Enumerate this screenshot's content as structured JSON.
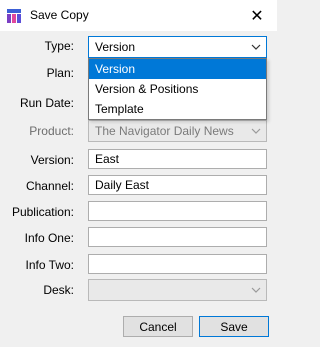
{
  "window": {
    "title": "Save Copy",
    "icon": "save-copy-app-icon",
    "close_glyph": "✕"
  },
  "form": {
    "type": {
      "label": "Type:",
      "value": "Version",
      "options": [
        "Version",
        "Version & Positions",
        "Template"
      ]
    },
    "plan": {
      "label": "Plan:"
    },
    "run_date": {
      "label": "Run Date:"
    },
    "product": {
      "label": "Product:",
      "value": "The Navigator Daily News"
    },
    "version": {
      "label": "Version:",
      "value": "East"
    },
    "channel": {
      "label": "Channel:",
      "value": "Daily East"
    },
    "publication": {
      "label": "Publication:",
      "value": ""
    },
    "info_one": {
      "label": "Info One:",
      "value": ""
    },
    "info_two": {
      "label": "Info Two:",
      "value": ""
    },
    "desk": {
      "label": "Desk:",
      "value": ""
    }
  },
  "buttons": {
    "cancel": "Cancel",
    "save": "Save"
  },
  "colors": {
    "accent": "#0078d7",
    "disabled_bg": "#e9e9e9"
  }
}
